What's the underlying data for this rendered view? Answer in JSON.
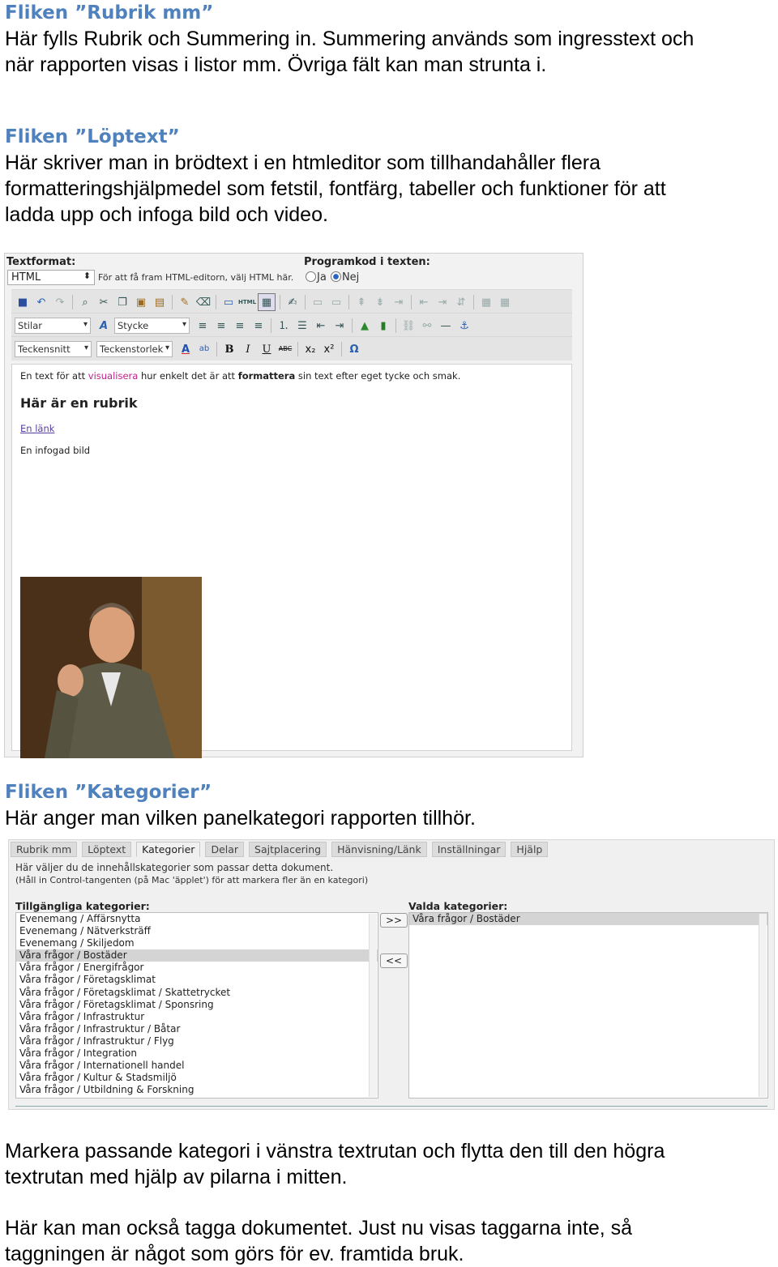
{
  "section1": {
    "heading": "Fliken ”Rubrik mm”",
    "lines": [
      "Här fylls Rubrik och Summering in. Summering används som ingresstext och",
      "när rapporten visas i listor mm. Övriga fält kan man strunta i."
    ]
  },
  "section2": {
    "heading": "Fliken ”Löptext”",
    "lines": [
      "Här skriver man in brödtext i en htmleditor som tillhandahåller flera",
      "formatteringshjälpmedel som fetstil, fontfärg, tabeller och funktioner för att",
      "ladda upp och infoga bild och video."
    ]
  },
  "editor": {
    "textformat_label": "Textformat:",
    "textformat_value": "HTML",
    "textformat_hint": "För att få fram HTML-editorn, välj HTML här.",
    "programkod_label": "Programkod i texten:",
    "radio_ja": "Ja",
    "radio_nej": "Nej",
    "styles_dropdown": "Stilar",
    "paragraph_dropdown": "Stycke",
    "font_dropdown": "Teckensnitt",
    "fontsize_dropdown": "Teckenstorlek",
    "html_icon_label": "HTML",
    "strike_icon_label": "ABC",
    "content": {
      "line1_before": "En text för att ",
      "line1_highlight": "visualisera",
      "line1_middle": " hur enkelt det är att ",
      "line1_bold": "formattera",
      "line1_after": " sin text efter eget tycke och smak.",
      "heading": "Här är en rubrik",
      "link": "En länk",
      "image_caption": "En infogad bild"
    }
  },
  "section3": {
    "heading": "Fliken ”Kategorier”",
    "line": "Här anger man vilken panelkategori rapporten tillhör."
  },
  "categories": {
    "tabs": [
      "Rubrik mm",
      "Löptext",
      "Kategorier",
      "Delar",
      "Sajtplacering",
      "Hänvisning/Länk",
      "Inställningar",
      "Hjälp"
    ],
    "active_tab": "Kategorier",
    "note1": "Här väljer du de innehållskategorier som passar detta dokument.",
    "note2": "(Håll in Control-tangenten (på Mac 'äpplet') för att markera fler än en kategori)",
    "available_label": "Tillgängliga kategorier:",
    "selected_label": "Valda kategorier:",
    "add_button": ">>",
    "remove_button": "<<",
    "available": [
      "Evenemang / Affärsnytta",
      "Evenemang / Nätverksträff",
      "Evenemang / Skiljedom",
      "Våra frågor / Bostäder",
      "Våra frågor / Energifrågor",
      "Våra frågor / Företagsklimat",
      "Våra frågor / Företagsklimat / Skattetrycket",
      "Våra frågor / Företagsklimat / Sponsring",
      "Våra frågor / Infrastruktur",
      "Våra frågor / Infrastruktur / Båtar",
      "Våra frågor / Infrastruktur / Flyg",
      "Våra frågor / Integration",
      "Våra frågor / Internationell handel",
      "Våra frågor / Kultur & Stadsmiljö",
      "Våra frågor / Utbildning & Forskning"
    ],
    "highlighted": "Våra frågor / Bostäder",
    "selected": [
      "Våra frågor / Bostäder"
    ]
  },
  "section4": {
    "lines": [
      "Markera passande kategori i vänstra textrutan och flytta den till den högra",
      "textrutan med hjälp av pilarna i mitten."
    ]
  },
  "section5": {
    "lines": [
      "Här kan man också tagga dokumentet. Just nu visas taggarna inte, så",
      "taggningen är något som görs för ev. framtida bruk."
    ]
  }
}
